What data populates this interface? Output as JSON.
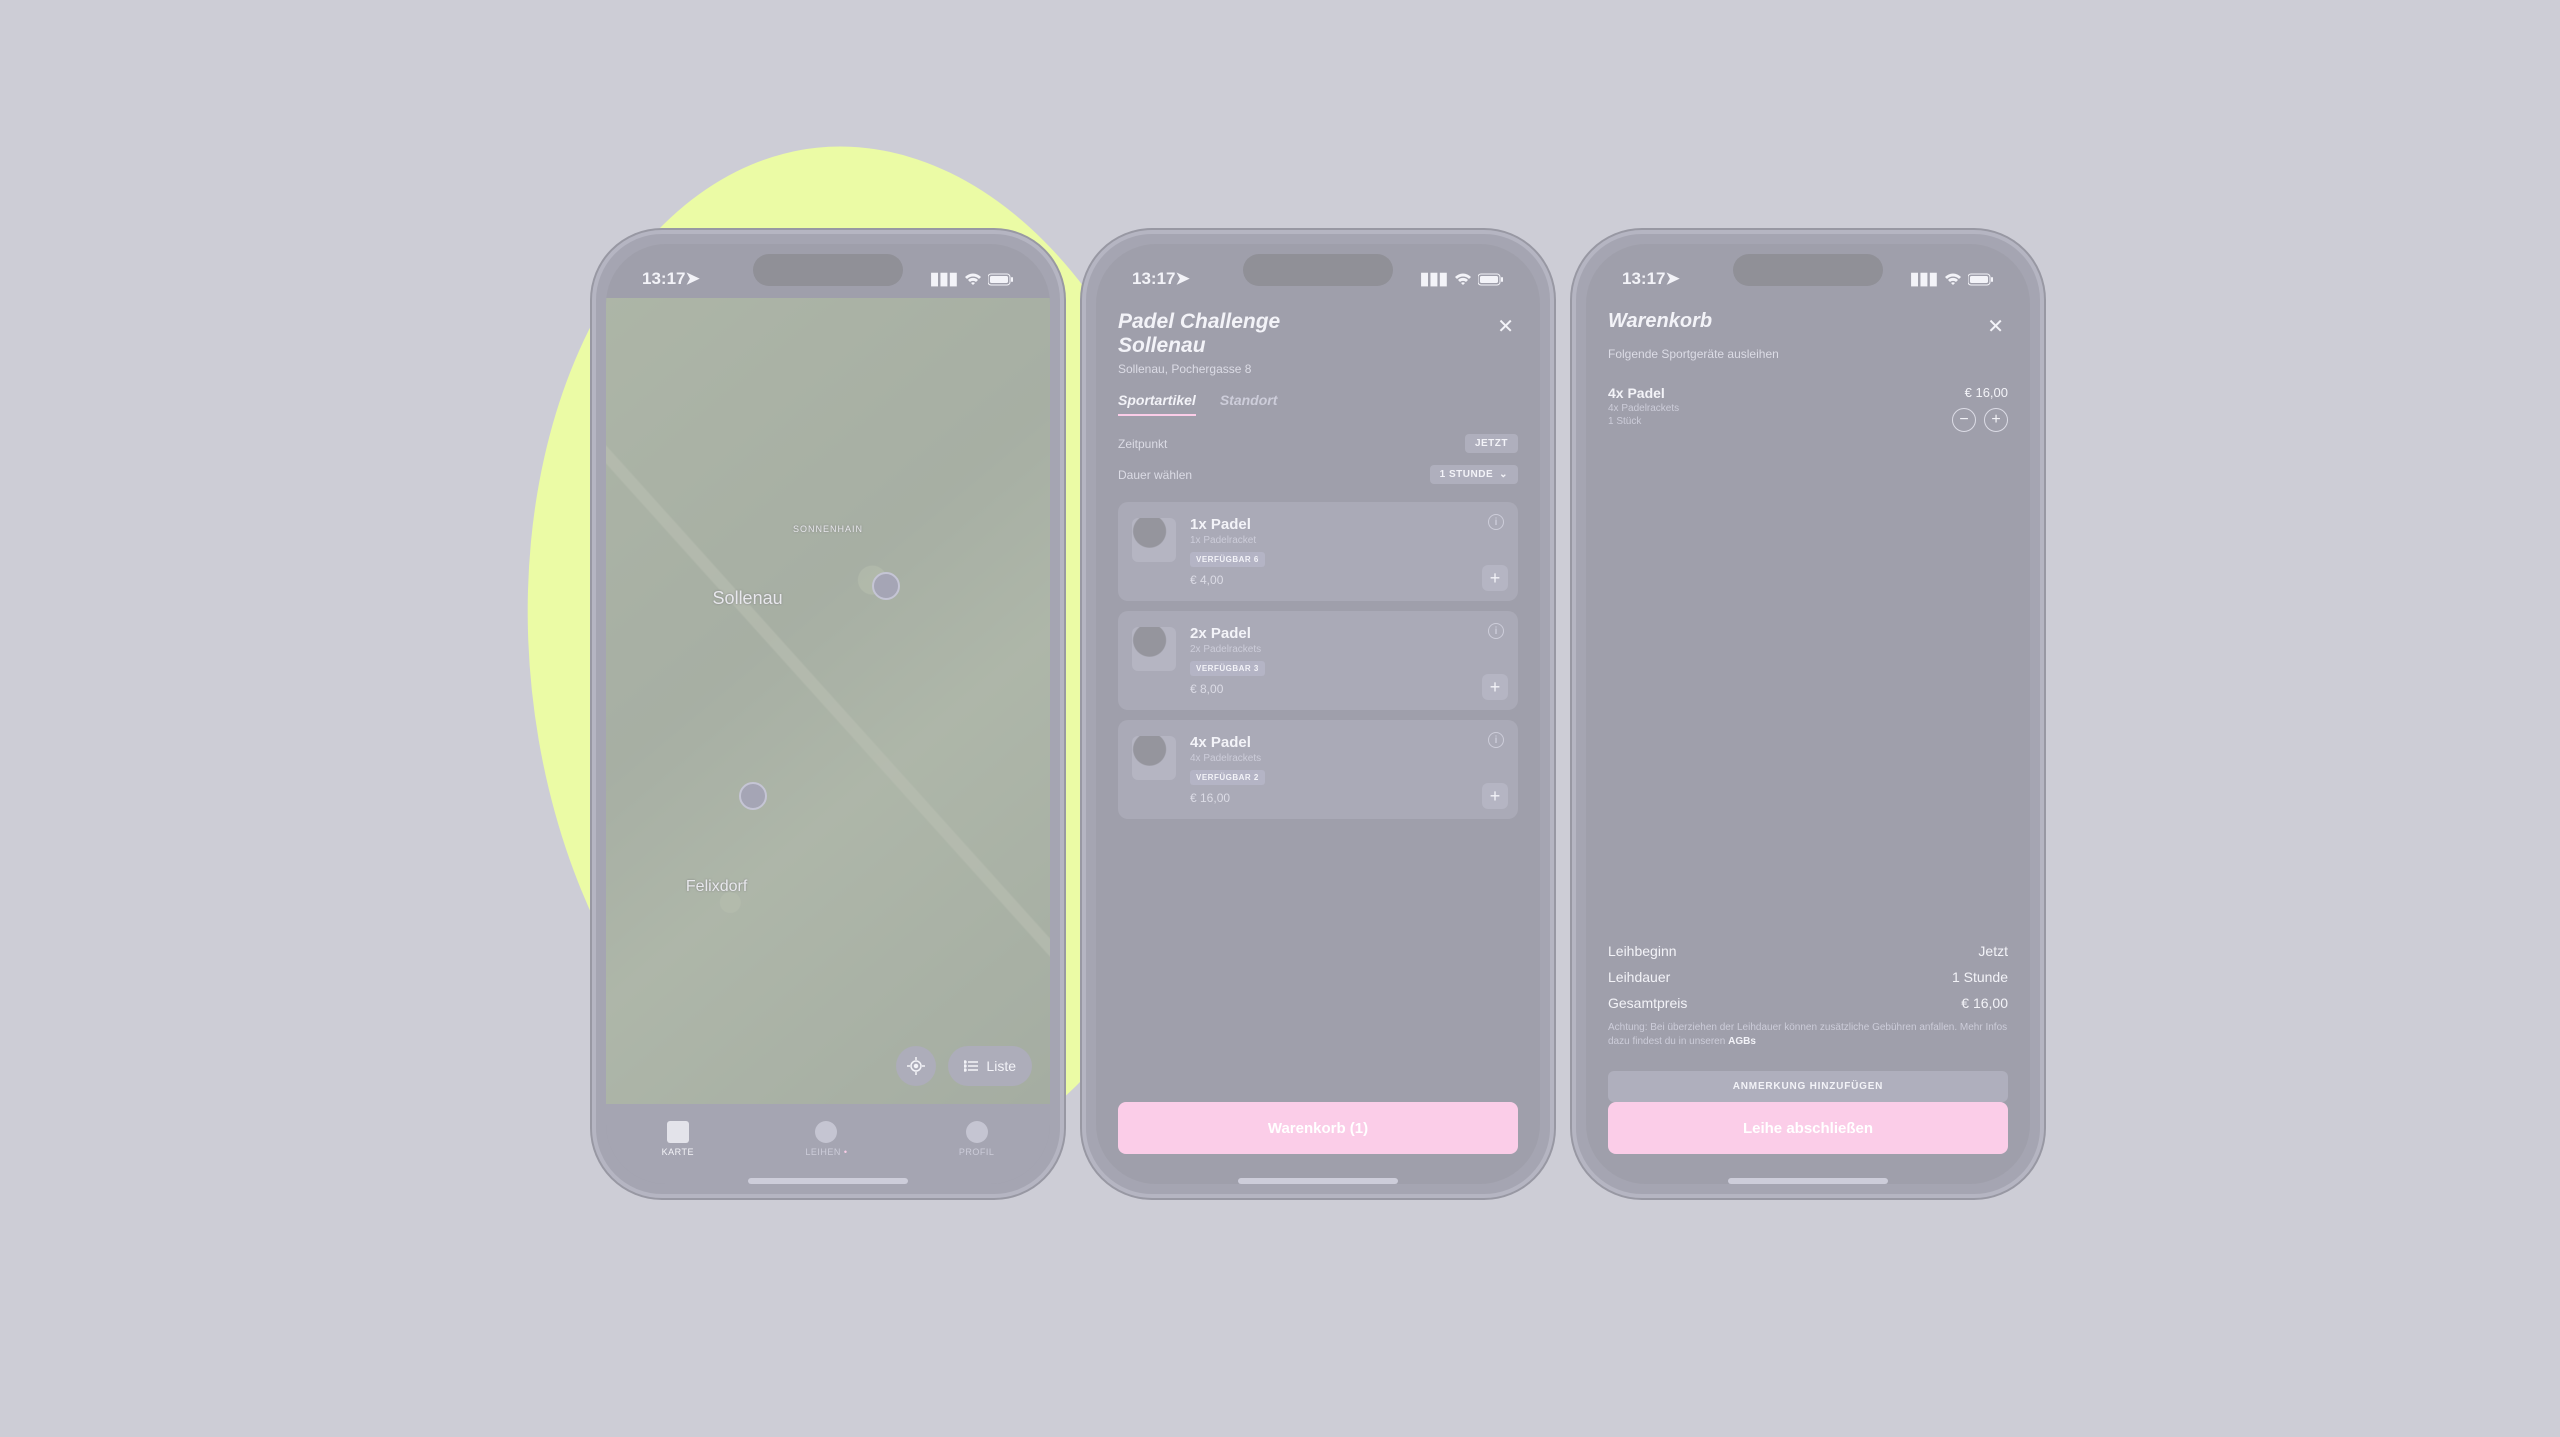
{
  "statusbar": {
    "time": "13:17"
  },
  "map": {
    "labels": {
      "sonnenhain": "SONNENHAIN",
      "sollenau": "Sollenau",
      "felixdorf": "Felixdorf"
    },
    "locate_aria": "locate",
    "list_button": "Liste"
  },
  "tabbar": {
    "karte": "KARTE",
    "leihen": "LEIHEN",
    "profil": "PROFIL"
  },
  "detail": {
    "title_line1": "Padel Challenge",
    "title_line2": "Sollenau",
    "address": "Sollenau, Pochergasse 8",
    "tab_sportartikel": "Sportartikel",
    "tab_standort": "Standort",
    "zeitpunkt_label": "Zeitpunkt",
    "zeitpunkt_value": "JETZT",
    "dauer_label": "Dauer wählen",
    "dauer_value": "1 STUNDE",
    "items": [
      {
        "title": "1x Padel",
        "sub": "1x Padelracket",
        "avail": "VERFÜGBAR 6",
        "price": "€ 4,00"
      },
      {
        "title": "2x Padel",
        "sub": "2x Padelrackets",
        "avail": "VERFÜGBAR 3",
        "price": "€ 8,00"
      },
      {
        "title": "4x Padel",
        "sub": "4x Padelrackets",
        "avail": "VERFÜGBAR 2",
        "price": "€ 16,00"
      }
    ],
    "cart_button": "Warenkorb (1)"
  },
  "cart": {
    "title": "Warenkorb",
    "subtitle": "Folgende Sportgeräte ausleihen",
    "item": {
      "title": "4x Padel",
      "sub1": "4x Padelrackets",
      "sub2": "1 Stück",
      "price": "€ 16,00"
    },
    "summary": {
      "leihbeginn_label": "Leihbeginn",
      "leihbeginn_value": "Jetzt",
      "leihdauer_label": "Leihdauer",
      "leihdauer_value": "1 Stunde",
      "gesamt_label": "Gesamtpreis",
      "gesamt_value": "€ 16,00"
    },
    "note_text": "Achtung: Bei überziehen der Leihdauer können zusätzliche Gebühren anfallen. Mehr Infos dazu findest du in unseren ",
    "note_link": "AGBs",
    "add_note_button": "ANMERKUNG HINZUFÜGEN",
    "checkout_button": "Leihe abschließen"
  }
}
